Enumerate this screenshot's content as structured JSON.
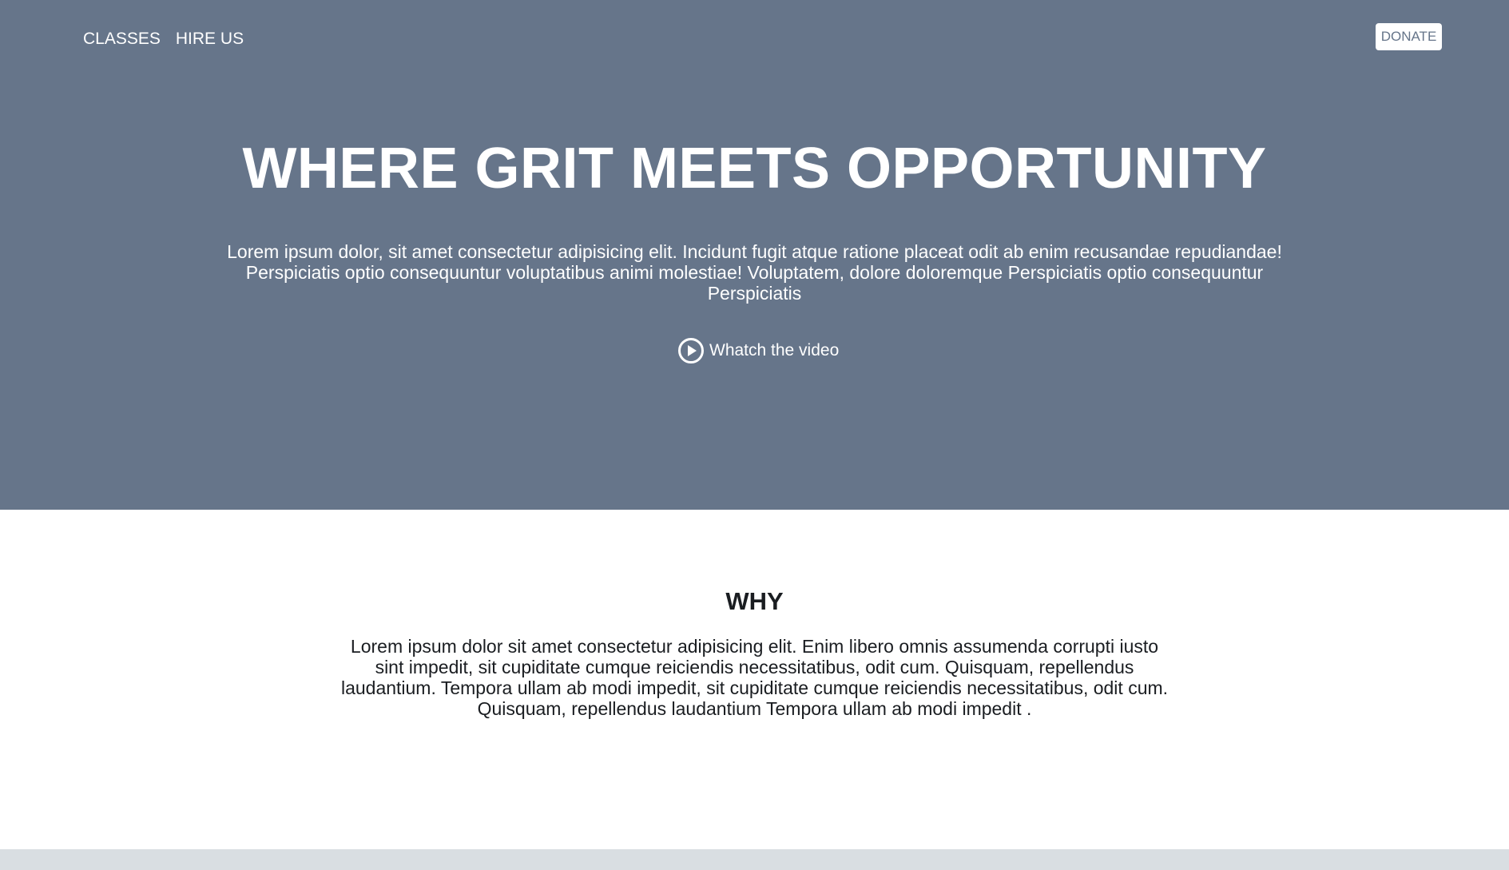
{
  "nav": {
    "items": [
      {
        "label": "CLASSES"
      },
      {
        "label": "HIRE US"
      }
    ],
    "donate_label": "DONATE"
  },
  "hero": {
    "title": "WHERE GRIT MEETS OPPORTUNITY",
    "text": "Lorem ipsum dolor, sit amet consectetur adipisicing elit. Incidunt fugit atque ratione placeat odit ab enim recusandae repudiandae! Perspiciatis optio consequuntur voluptatibus animi molestiae! Voluptatem, dolore doloremque Perspiciatis optio consequuntur Perspiciatis",
    "video_label": "Whatch the video",
    "video_icon": "play-circle-icon"
  },
  "why": {
    "title": "WHY",
    "text": "Lorem ipsum dolor sit amet consectetur adipisicing elit. Enim libero omnis assumenda corrupti iusto sint impedit, sit cupiditate cumque reiciendis necessitatibus, odit cum. Quisquam, repellendus laudantium. Tempora ullam ab modi impedit, sit cupiditate cumque reiciendis necessitatibus, odit cum. Quisquam, repellendus laudantium Tempora ullam ab modi impedit ."
  },
  "colors": {
    "hero_bg": "#66758a",
    "hero_text": "#ffffff",
    "body_text": "#1a1d21",
    "footer_bg": "#d9dee2"
  }
}
